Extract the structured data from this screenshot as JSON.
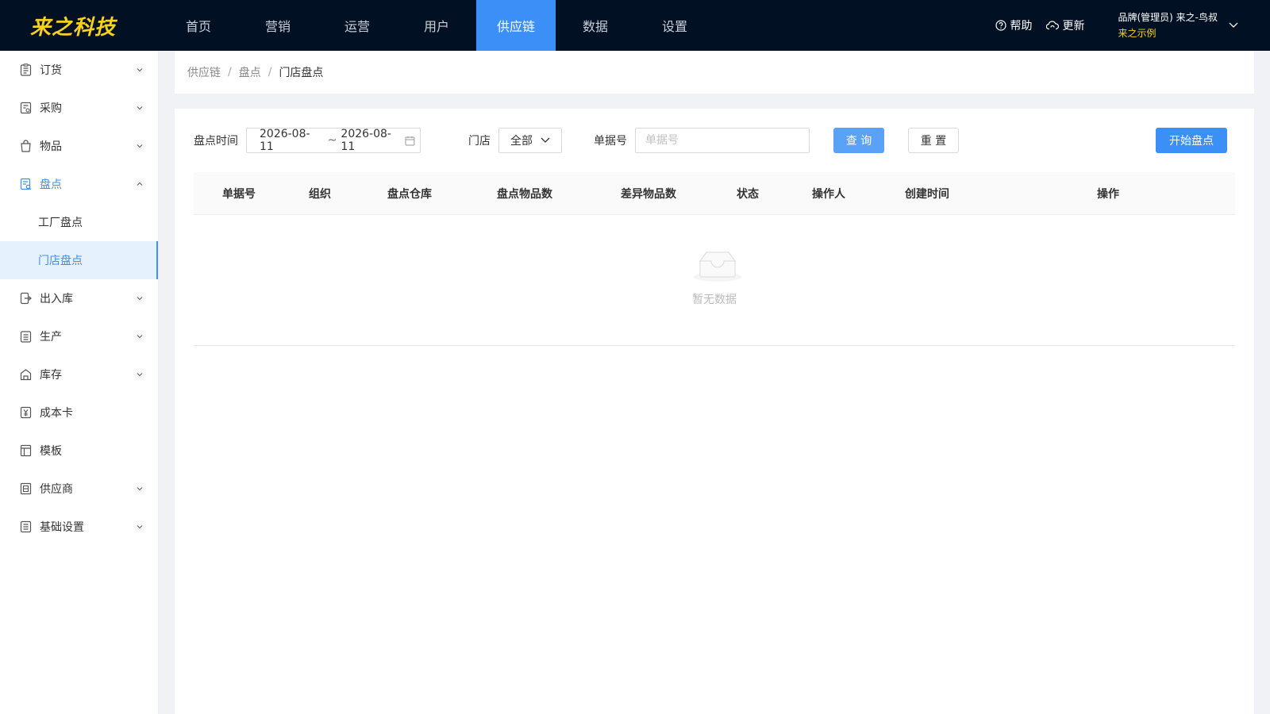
{
  "app": {
    "logo_text": "来之科技",
    "nav": [
      {
        "label": "首页"
      },
      {
        "label": "营销"
      },
      {
        "label": "运营"
      },
      {
        "label": "用户"
      },
      {
        "label": "供应链"
      },
      {
        "label": "数据"
      },
      {
        "label": "设置"
      }
    ],
    "active_nav": "供应链",
    "help_label": "帮助",
    "update_label": "更新",
    "user_line1": "品牌(管理员)  来之-鸟叔",
    "user_line2": "来之示例"
  },
  "sidebar": {
    "items": [
      {
        "label": "订货",
        "icon": "clipboard-icon"
      },
      {
        "label": "采购",
        "icon": "purchase-icon"
      },
      {
        "label": "物品",
        "icon": "bag-icon"
      },
      {
        "label": "盘点",
        "icon": "inventory-check-icon",
        "open": true,
        "children": [
          {
            "label": "工厂盘点"
          },
          {
            "label": "门店盘点",
            "active": true
          }
        ]
      },
      {
        "label": "出入库",
        "icon": "in-out-icon"
      },
      {
        "label": "生产",
        "icon": "production-icon"
      },
      {
        "label": "库存",
        "icon": "warehouse-icon"
      },
      {
        "label": "成本卡",
        "icon": "cost-card-icon"
      },
      {
        "label": "模板",
        "icon": "template-icon"
      },
      {
        "label": "供应商",
        "icon": "supplier-icon"
      },
      {
        "label": "基础设置",
        "icon": "settings-list-icon"
      }
    ]
  },
  "breadcrumb": [
    "供应链",
    "盘点",
    "门店盘点"
  ],
  "breadcrumb_sep": "/",
  "filters": {
    "date_label": "盘点时间",
    "date_start": "2026-08-11",
    "date_sep": "~",
    "date_end": "2026-08-11",
    "store_label": "门店",
    "store_value": "全部",
    "doc_label": "单据号",
    "doc_placeholder": "单据号",
    "query_label": "查 询",
    "reset_label": "重 置",
    "start_label": "开始盘点"
  },
  "table": {
    "columns": [
      "单据号",
      "组织",
      "盘点仓库",
      "盘点物品数",
      "差异物品数",
      "状态",
      "操作人",
      "创建时间",
      "操作"
    ],
    "rows": [],
    "empty_text": "暂无数据"
  },
  "colors": {
    "topbar": "#021024",
    "accent": "#3c8ff6",
    "logo": "#f7d21c"
  }
}
